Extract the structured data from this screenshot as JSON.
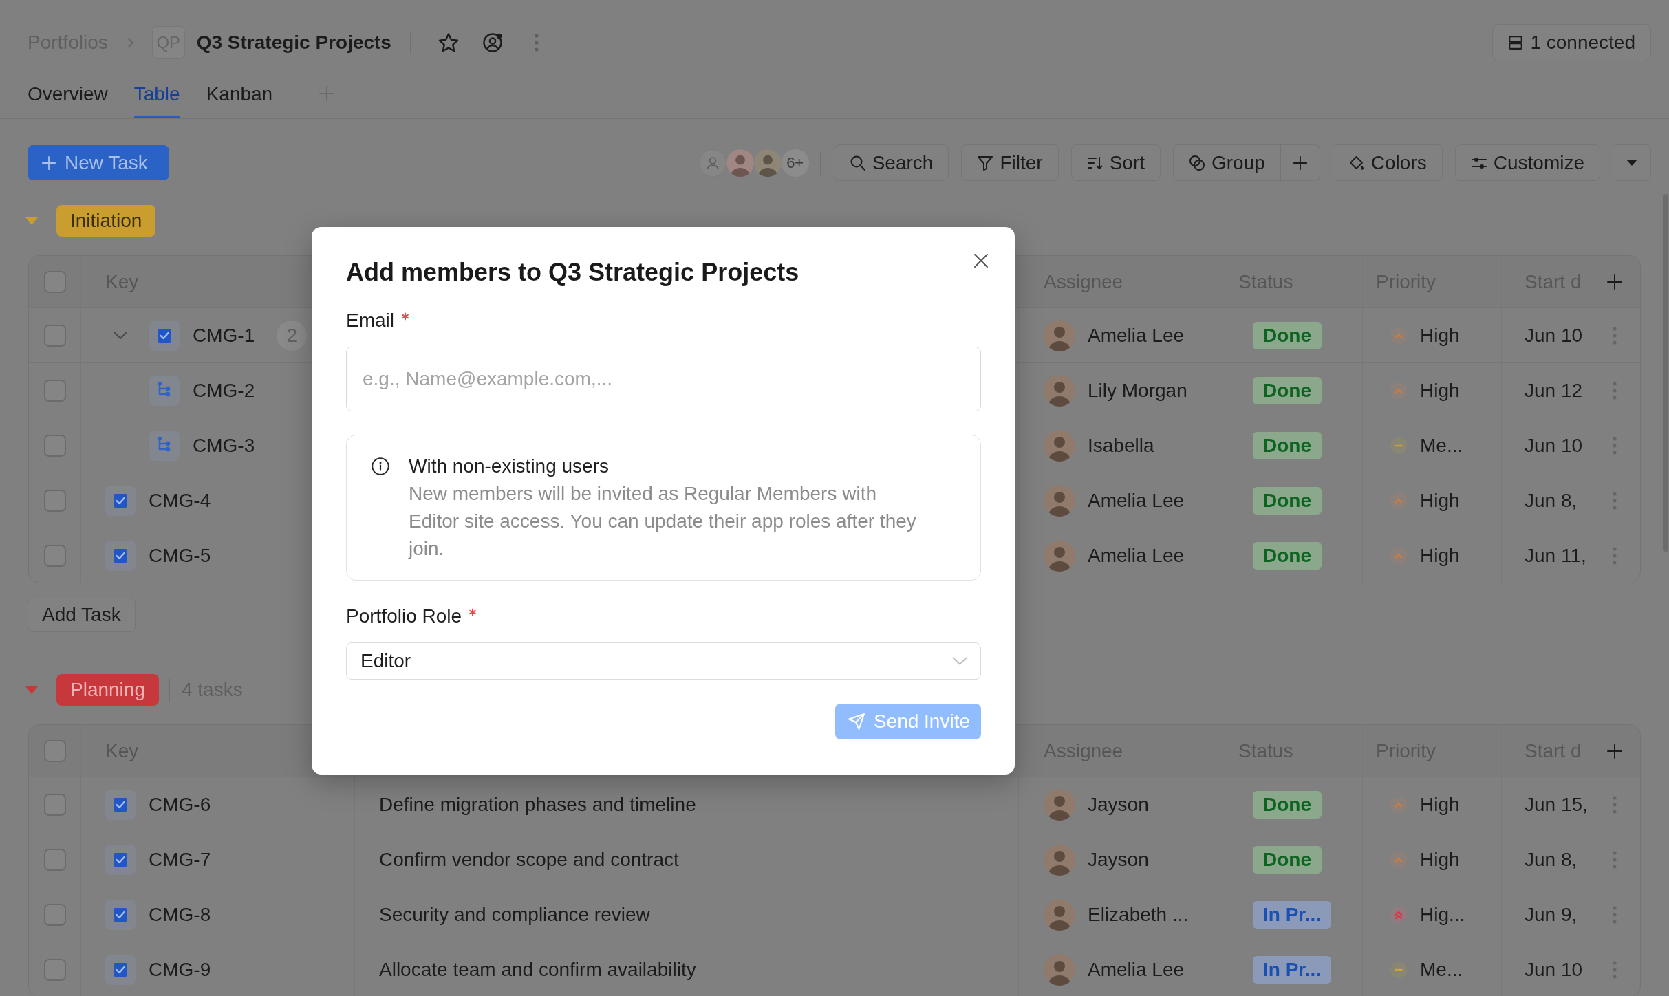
{
  "breadcrumb": {
    "root": "Portfolios",
    "project_initials": "QP",
    "project_name": "Q3 Strategic Projects"
  },
  "connection": {
    "label": "1 connected"
  },
  "tabs": [
    {
      "label": "Overview",
      "selected": false
    },
    {
      "label": "Table",
      "selected": true
    },
    {
      "label": "Kanban",
      "selected": false
    }
  ],
  "toolbar": {
    "new_task": "New Task",
    "members_more": "6+",
    "buttons": [
      {
        "kind": "search",
        "label": "Search"
      },
      {
        "kind": "filter",
        "label": "Filter"
      },
      {
        "kind": "sort",
        "label": "Sort"
      },
      {
        "kind": "group",
        "label": "Group"
      },
      {
        "kind": "colors",
        "label": "Colors"
      },
      {
        "kind": "customize",
        "label": "Customize"
      }
    ]
  },
  "groups": [
    {
      "name": "Initiation",
      "color": "#c99e2e",
      "expanded": true,
      "header_checked": false,
      "columns": {
        "key": "Key",
        "assignee": "Assignee",
        "status": "Status",
        "priority": "Priority",
        "start": "Start d"
      },
      "rows": [
        {
          "key": "CMG-1",
          "kind": "task",
          "checked": false,
          "expanded": true,
          "subtasks": "2",
          "assignee": "Amelia Lee",
          "status": {
            "kind": "done",
            "label": "Done"
          },
          "priority": {
            "kind": "high",
            "label": "High"
          },
          "start": "Jun 10",
          "children": [
            {
              "key": "CMG-2",
              "kind": "subtask",
              "checked": false,
              "assignee": "Lily Morgan",
              "status": {
                "kind": "done",
                "label": "Done"
              },
              "priority": {
                "kind": "high",
                "label": "High"
              },
              "start": "Jun 12"
            },
            {
              "key": "CMG-3",
              "kind": "subtask",
              "checked": false,
              "assignee": "Isabella",
              "status": {
                "kind": "done",
                "label": "Done"
              },
              "priority": {
                "kind": "medium",
                "label": "Me..."
              },
              "start": "Jun 10"
            }
          ]
        },
        {
          "key": "CMG-4",
          "kind": "task",
          "checked": false,
          "assignee": "Amelia Lee",
          "status": {
            "kind": "done",
            "label": "Done"
          },
          "priority": {
            "kind": "high",
            "label": "High"
          },
          "start": "Jun 8,"
        },
        {
          "key": "CMG-5",
          "kind": "task",
          "checked": false,
          "assignee": "Amelia Lee",
          "status": {
            "kind": "done",
            "label": "Done"
          },
          "priority": {
            "kind": "high",
            "label": "High"
          },
          "start": "Jun 11,"
        }
      ],
      "add_task": "Add Task"
    },
    {
      "name": "Planning",
      "color": "#c7383d",
      "expanded": true,
      "count": "4 tasks",
      "header_checked": false,
      "columns": {
        "key": "Key",
        "assignee": "Assignee",
        "status": "Status",
        "priority": "Priority",
        "start": "Start d"
      },
      "rows": [
        {
          "key": "CMG-6",
          "kind": "task",
          "checked": false,
          "title": "Define migration phases and timeline",
          "assignee": "Jayson",
          "status": {
            "kind": "done",
            "label": "Done"
          },
          "priority": {
            "kind": "high",
            "label": "High"
          },
          "start": "Jun 15,"
        },
        {
          "key": "CMG-7",
          "kind": "task",
          "checked": false,
          "title": "Confirm vendor scope and contract",
          "assignee": "Jayson",
          "status": {
            "kind": "done",
            "label": "Done"
          },
          "priority": {
            "kind": "high",
            "label": "High"
          },
          "start": "Jun 8,"
        },
        {
          "key": "CMG-8",
          "kind": "task",
          "checked": false,
          "title": "Security and compliance review",
          "assignee": "Elizabeth ...",
          "status": {
            "kind": "progress",
            "label": "In Pr..."
          },
          "priority": {
            "kind": "highest",
            "label": "Hig..."
          },
          "start": "Jun 9,"
        },
        {
          "key": "CMG-9",
          "kind": "task",
          "checked": false,
          "title": "Allocate team and confirm availability",
          "assignee": "Amelia Lee",
          "status": {
            "kind": "progress",
            "label": "In Pr..."
          },
          "priority": {
            "kind": "medium",
            "label": "Me..."
          },
          "start": "Jun 10"
        }
      ]
    }
  ],
  "modal": {
    "title": "Add members to Q3 Strategic Projects",
    "email": {
      "label": "Email",
      "required": true,
      "placeholder": "e.g., Name@example.com,..."
    },
    "notice": {
      "title": "With non-existing users",
      "text": "New members will be invited as Regular Members with Editor site access. You can update their app roles after they join."
    },
    "role": {
      "label": "Portfolio Role",
      "required": true,
      "value": "Editor"
    },
    "submit": {
      "label": "Send Invite",
      "disabled": true
    }
  }
}
